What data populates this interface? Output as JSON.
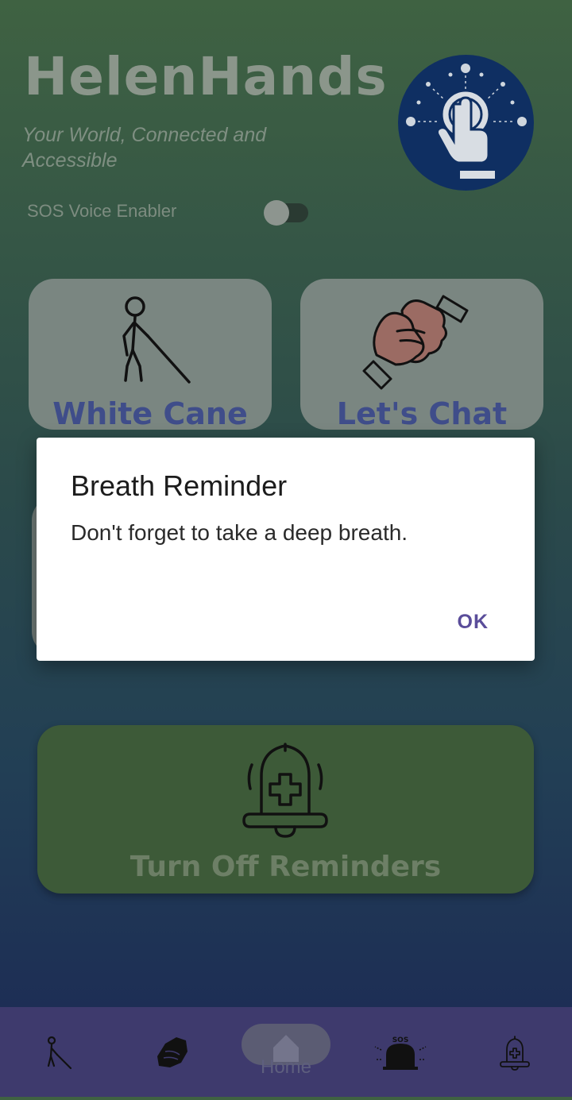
{
  "header": {
    "app_title": "HelenHands",
    "tagline": "Your World, Connected and Accessible",
    "logo_icon": "tap-hand-icon"
  },
  "sos": {
    "label": "SOS Voice Enabler",
    "enabled": false
  },
  "cards": [
    {
      "label": "White Cane",
      "icon": "white-cane-person-icon"
    },
    {
      "label": "Let's Chat",
      "icon": "sign-language-hands-icon"
    }
  ],
  "reminder_button": {
    "label": "Turn Off Reminders",
    "icon": "medical-bell-icon"
  },
  "dialog": {
    "title": "Breath Reminder",
    "message": "Don't forget to take a deep breath.",
    "ok_label": "OK"
  },
  "bottom_nav": {
    "items": [
      {
        "icon": "white-cane-person-icon"
      },
      {
        "icon": "sign-language-hands-icon"
      },
      {
        "label": "Home",
        "icon": "home-icon",
        "active": true
      },
      {
        "icon": "sos-siren-icon",
        "badge": "SOS"
      },
      {
        "icon": "medical-bell-icon"
      }
    ]
  },
  "colors": {
    "background_top": "#3f6242",
    "background_bottom": "#1d2e55",
    "card": "#7a8681",
    "card_label": "#3f4d8a",
    "reminder_button": "#3d5a38",
    "logo_circle": "#0f2f62",
    "nav_bar": "#3e3a6d",
    "dialog_accent": "#5a4d9a"
  }
}
